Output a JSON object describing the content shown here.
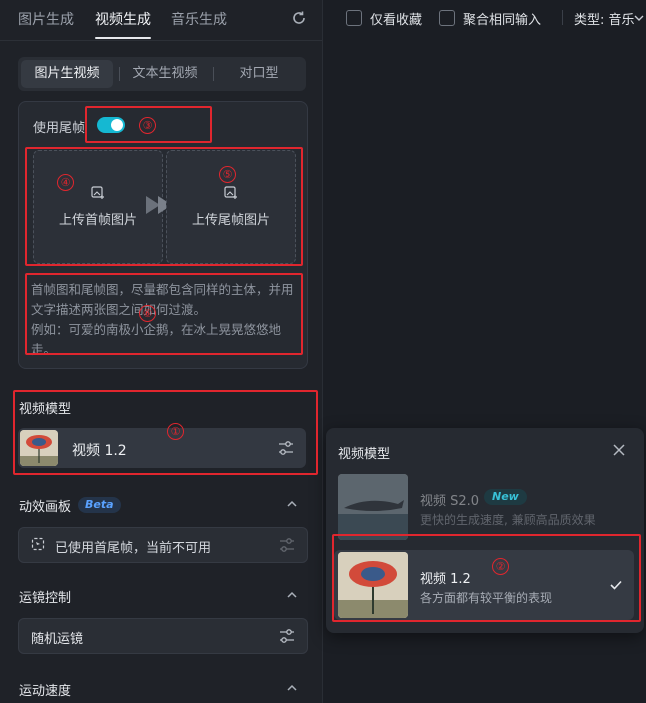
{
  "tabs": {
    "image": "图片生成",
    "video": "视频生成",
    "music": "音乐生成"
  },
  "mode_tabs": [
    "图片生视频",
    "文本生视频",
    "对口型"
  ],
  "frames": {
    "use_tail_label": "使用尾帧",
    "toggle_on": true,
    "upload_first": "上传首帧图片",
    "upload_last": "上传尾帧图片",
    "description": "首帧图和尾帧图，尽量都包含同样的主体，并用文字描述两张图之间如何过渡。\n例如：可爱的南极小企鹅，在冰上晃晃悠悠地走。"
  },
  "video_model": {
    "title": "视频模型",
    "selected": "视频 1.2"
  },
  "motion_board": {
    "title": "动效画板",
    "badge": "Beta",
    "status": "已使用首尾帧，当前不可用"
  },
  "camera": {
    "title": "运镜控制",
    "value": "随机运镜"
  },
  "speed": {
    "title": "运动速度"
  },
  "right_bar": {
    "favorites_only": "仅看收藏",
    "merge_same_input": "聚合相同输入",
    "type_label": "类型: 音乐"
  },
  "popup": {
    "title": "视频模型",
    "options": [
      {
        "name": "视频 S2.0",
        "badge": "New",
        "desc": "更快的生成速度, 兼顾高品质效果",
        "selected": false
      },
      {
        "name": "视频 1.2",
        "desc": "各方面都有较平衡的表现",
        "selected": true
      }
    ]
  },
  "annotations": [
    "①",
    "②",
    "③",
    "④",
    "⑤",
    "⑥"
  ],
  "colors": {
    "accent": "#15b8d2",
    "annotation": "#e0262e",
    "beta": "#5aa2ff"
  }
}
